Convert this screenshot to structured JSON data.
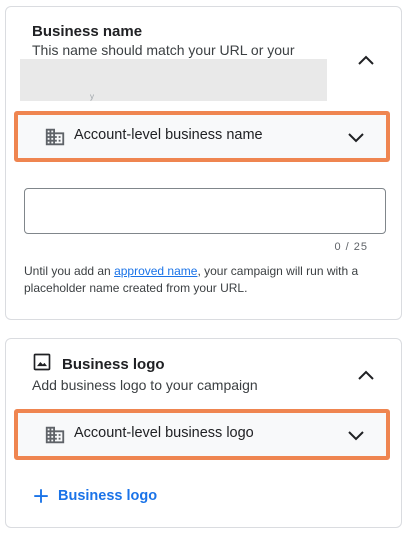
{
  "business_name": {
    "title": "Business name",
    "subtitle": "This name should match your URL or your",
    "subtitle_tail": "y",
    "select_label": "Account-level business name",
    "input_value": "",
    "counter": "0 / 25",
    "helper_before": "Until you add an ",
    "helper_link": "approved name",
    "helper_after": ", your campaign will run with a placeholder name created from your URL."
  },
  "business_logo": {
    "title": "Business logo",
    "subtitle": "Add business logo to your campaign",
    "select_label": "Account-level business logo",
    "add_button_label": "Business logo"
  },
  "colors": {
    "highlight_border": "#ef8550",
    "link": "#1a73e8",
    "card_border": "#dadce0"
  },
  "icons": [
    "building-icon",
    "chevron-up-icon",
    "chevron-down-icon",
    "image-icon",
    "plus-icon"
  ]
}
